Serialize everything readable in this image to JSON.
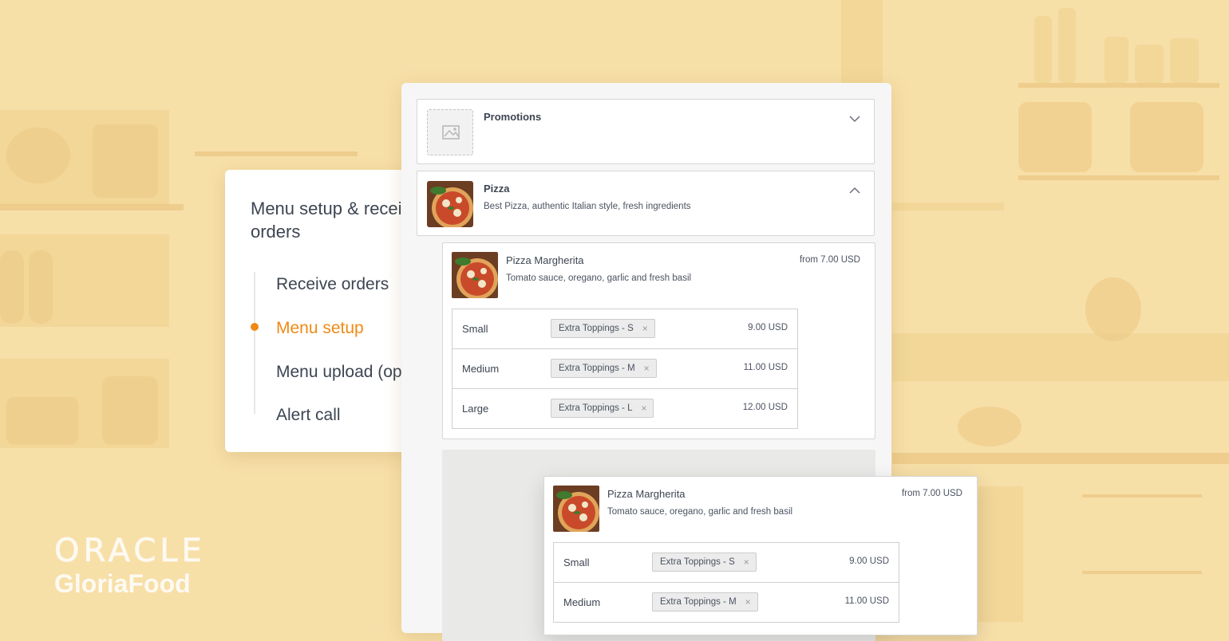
{
  "steps": {
    "title": "Menu setup & receive\norders",
    "items": [
      {
        "label": "Receive orders"
      },
      {
        "label": "Menu setup"
      },
      {
        "label": "Menu upload (optional)"
      },
      {
        "label": "Alert call"
      }
    ],
    "active_index": 1,
    "accent_color": "#f08a14"
  },
  "menu": {
    "categories": [
      {
        "name": "Promotions",
        "description": "",
        "icon": "image-placeholder-icon",
        "expanded": false
      },
      {
        "name": "Pizza",
        "description": "Best Pizza, authentic Italian style, fresh ingredients",
        "icon": "pizza-photo",
        "expanded": true
      }
    ],
    "item": {
      "name": "Pizza Margherita",
      "description": "Tomato sauce, oregano, garlic and fresh basil",
      "price": "from 7.00 USD",
      "sizes": [
        {
          "name": "Small",
          "topping": "Extra Toppings - S",
          "price": "9.00 USD"
        },
        {
          "name": "Medium",
          "topping": "Extra Toppings - M",
          "price": "11.00 USD"
        },
        {
          "name": "Large",
          "topping": "Extra Toppings - L",
          "price": "12.00 USD"
        }
      ]
    },
    "dragged_item": {
      "name": "Pizza Margherita",
      "description": "Tomato sauce, oregano, garlic and fresh basil",
      "price": "from 7.00 USD",
      "sizes": [
        {
          "name": "Small",
          "topping": "Extra Toppings - S",
          "price": "9.00 USD"
        },
        {
          "name": "Medium",
          "topping": "Extra Toppings - M",
          "price": "11.00 USD"
        }
      ]
    }
  },
  "brand": {
    "logo_top": "ORACLE",
    "logo_bottom": "GloriaFood"
  }
}
